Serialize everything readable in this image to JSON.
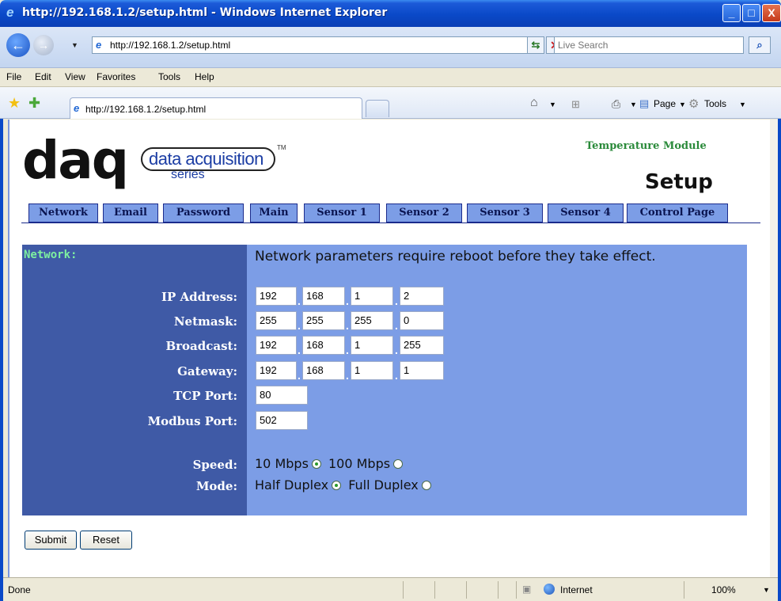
{
  "window": {
    "title": "http://192.168.1.2/setup.html - Windows Internet Explorer",
    "minimize_symbol": "_",
    "maximize_symbol": "□",
    "close_symbol": "X"
  },
  "addressbar": {
    "url": "http://192.168.1.2/setup.html",
    "search_placeholder": "Live Search"
  },
  "menu": [
    "File",
    "Edit",
    "View",
    "Favorites",
    "Tools",
    "Help"
  ],
  "tab": {
    "label": "http://192.168.1.2/setup.html"
  },
  "commandbar": {
    "page_label": "Page",
    "tools_label": "Tools"
  },
  "logo": {
    "main": "daq",
    "pill": "data acquisition",
    "series": "series",
    "tm": "TM"
  },
  "header": {
    "module": "Temperature Module",
    "title": "Setup"
  },
  "nav": [
    "Network",
    "Email",
    "Password",
    "Main",
    "Sensor 1",
    "Sensor 2",
    "Sensor 3",
    "Sensor 4",
    "Control Page"
  ],
  "form": {
    "heading": "Network:",
    "notice": "Network parameters require reboot before they take effect.",
    "ip_label": "IP Address:",
    "ip": [
      "192",
      "168",
      "1",
      "2"
    ],
    "netmask_label": "Netmask:",
    "netmask": [
      "255",
      "255",
      "255",
      "0"
    ],
    "broadcast_label": "Broadcast:",
    "broadcast": [
      "192",
      "168",
      "1",
      "255"
    ],
    "gateway_label": "Gateway:",
    "gateway": [
      "192",
      "168",
      "1",
      "1"
    ],
    "tcp_label": "TCP Port:",
    "tcp_port": "80",
    "modbus_label": "Modbus Port:",
    "modbus_port": "502",
    "speed_label": "Speed:",
    "speed_options": [
      "10 Mbps",
      "100 Mbps"
    ],
    "speed_selected": "10 Mbps",
    "mode_label": "Mode:",
    "mode_options": [
      "Half Duplex",
      "Full Duplex"
    ],
    "mode_selected": "Half Duplex",
    "submit_label": "Submit",
    "reset_label": "Reset"
  },
  "statusbar": {
    "status": "Done",
    "zone": "Internet",
    "zoom": "100%"
  },
  "colors": {
    "panel_dark": "#3f5aa6",
    "panel_light": "#7c9de6",
    "heading_green": "#7ef0a0",
    "module_green": "#2a8a3a",
    "titlebar_blue": "#0a49c8"
  }
}
